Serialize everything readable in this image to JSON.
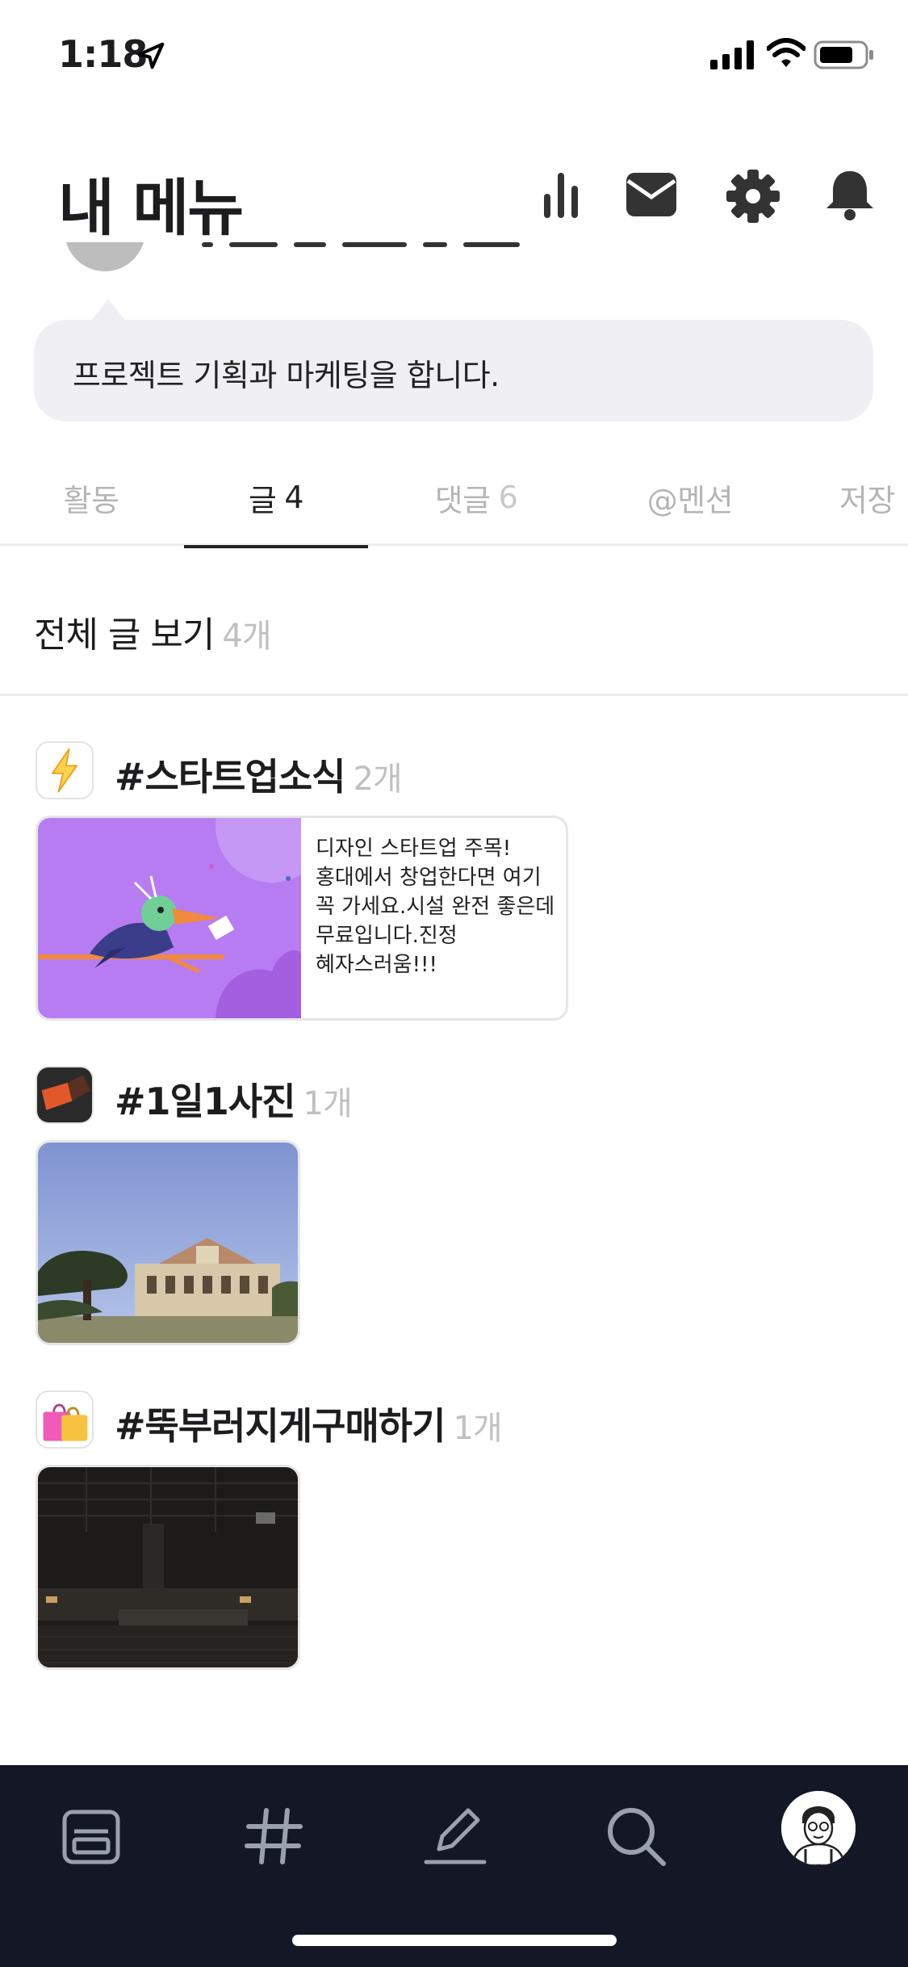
{
  "status_bar": {
    "time": "1:18"
  },
  "header": {
    "title": "내 메뉴"
  },
  "profile": {
    "bio": "프로젝트 기획과 마케팅을 합니다."
  },
  "tabs": [
    {
      "label": "활동",
      "count": ""
    },
    {
      "label": "글",
      "count": "4"
    },
    {
      "label": "댓글",
      "count": "6"
    },
    {
      "label": "@멘션",
      "count": ""
    },
    {
      "label": "저장",
      "count": ""
    }
  ],
  "section": {
    "title": "전체 글 보기",
    "count": "4개"
  },
  "groups": [
    {
      "name": "#스타트업소식",
      "count": "2개",
      "icon": "lightning-icon",
      "post_text": "디자인 스타트업 주목!홍대에서 창업한다면 여기 꼭 가세요.시설 완전 좋은데 무료입니다.진정 혜자스러움!!!"
    },
    {
      "name": "#1일1사진",
      "count": "1개",
      "icon": "photo-thumbnail"
    },
    {
      "name": "#뚝부러지게구매하기",
      "count": "1개",
      "icon": "shopping-bags-icon"
    }
  ],
  "colors": {
    "accent_dark": "#141826",
    "illustration_purple": "#b77cf2",
    "muted_text": "#c0c0c0"
  }
}
